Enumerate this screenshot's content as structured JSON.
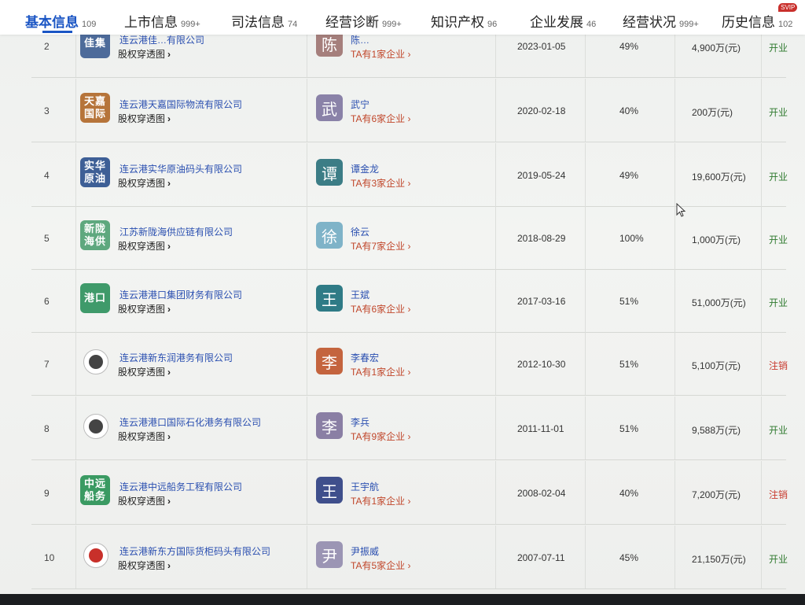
{
  "tabs": [
    {
      "label": "基本信息",
      "count": "109",
      "active": true
    },
    {
      "label": "上市信息",
      "count": "999+"
    },
    {
      "label": "司法信息",
      "count": "74"
    },
    {
      "label": "经营诊断",
      "count": "999+"
    },
    {
      "label": "知识产权",
      "count": "96"
    },
    {
      "label": "企业发展",
      "count": "46"
    },
    {
      "label": "经营状况",
      "count": "999+"
    },
    {
      "label": "历史信息",
      "count": "102",
      "badge": "SVIP"
    }
  ],
  "equity_link_label": "股权穿透图",
  "rows": [
    {
      "idx": "2",
      "logo": "佳集",
      "logo_color": "#4d6b9a",
      "company": "连云港佳…有限公司",
      "avatar": "陈",
      "avatar_color": "#a57f7c",
      "person": "陈…",
      "ta": "TA有1家企业",
      "date": "2023-01-05",
      "pct": "49%",
      "capital": "4,900万(元)",
      "status": "开业",
      "status_type": "open"
    },
    {
      "idx": "3",
      "logo": "天嘉国际",
      "logo_color": "#b6743a",
      "company": "连云港天嘉国际物流有限公司",
      "avatar": "武",
      "avatar_color": "#8a82a8",
      "person": "武宁",
      "ta": "TA有6家企业",
      "date": "2020-02-18",
      "pct": "40%",
      "capital": "200万(元)",
      "status": "开业",
      "status_type": "open"
    },
    {
      "idx": "4",
      "logo": "实华原油",
      "logo_color": "#3e5f96",
      "company": "连云港实华原油码头有限公司",
      "avatar": "谭",
      "avatar_color": "#3c7d86",
      "person": "谭金龙",
      "ta": "TA有3家企业",
      "date": "2019-05-24",
      "pct": "49%",
      "capital": "19,600万(元)",
      "status": "开业",
      "status_type": "open"
    },
    {
      "idx": "5",
      "logo": "新陇海供",
      "logo_color": "#5ea87e",
      "company": "江苏新陇海供应链有限公司",
      "avatar": "徐",
      "avatar_color": "#7fb3c8",
      "person": "徐云",
      "ta": "TA有7家企业",
      "date": "2018-08-29",
      "pct": "100%",
      "capital": "1,000万(元)",
      "status": "开业",
      "status_type": "open"
    },
    {
      "idx": "6",
      "logo": "港口",
      "logo_color": "#3f9a6a",
      "company": "连云港港口集团财务有限公司",
      "avatar": "王",
      "avatar_color": "#2f7b86",
      "person": "王斌",
      "ta": "TA有6家企业",
      "date": "2017-03-16",
      "pct": "51%",
      "capital": "51,000万(元)",
      "status": "开业",
      "status_type": "open"
    },
    {
      "idx": "7",
      "logo": "",
      "logo_color": "round",
      "company": "连云港新东润港务有限公司",
      "avatar": "李",
      "avatar_color": "#c4643e",
      "person": "李春宏",
      "ta": "TA有1家企业",
      "date": "2012-10-30",
      "pct": "51%",
      "capital": "5,100万(元)",
      "status": "注销",
      "status_type": "closed"
    },
    {
      "idx": "8",
      "logo": "",
      "logo_color": "round",
      "company": "连云港港口国际石化港务有限公司",
      "avatar": "李",
      "avatar_color": "#8a7fa4",
      "person": "李兵",
      "ta": "TA有9家企业",
      "date": "2011-11-01",
      "pct": "51%",
      "capital": "9,588万(元)",
      "status": "开业",
      "status_type": "open"
    },
    {
      "idx": "9",
      "logo": "中远船务",
      "logo_color": "#3a9a62",
      "company": "连云港中远船务工程有限公司",
      "avatar": "王",
      "avatar_color": "#3f4f8c",
      "person": "王宇航",
      "ta": "TA有1家企业",
      "date": "2008-02-04",
      "pct": "40%",
      "capital": "7,200万(元)",
      "status": "注销",
      "status_type": "closed"
    },
    {
      "idx": "10",
      "logo": "",
      "logo_color": "round-red",
      "company": "连云港新东方国际货柜码头有限公司",
      "avatar": "尹",
      "avatar_color": "#9b95b4",
      "person": "尹振威",
      "ta": "TA有5家企业",
      "date": "2007-07-11",
      "pct": "45%",
      "capital": "21,150万(元)",
      "status": "开业",
      "status_type": "open"
    }
  ]
}
